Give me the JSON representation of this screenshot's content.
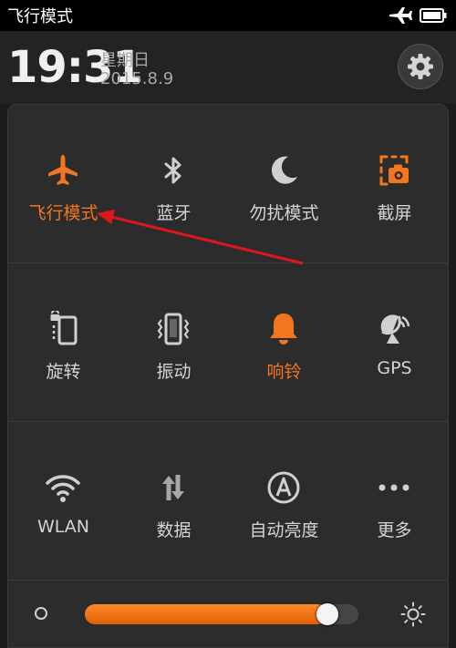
{
  "status_bar": {
    "title": "飞行模式",
    "icons": [
      "airplane-icon",
      "battery-icon"
    ]
  },
  "header": {
    "time": "19:31",
    "weekday": "星期日",
    "date": "2015.8.9",
    "settings_icon": "gear-icon"
  },
  "toggles": [
    {
      "label": "飞行模式",
      "icon": "airplane-icon",
      "active": true
    },
    {
      "label": "蓝牙",
      "icon": "bluetooth-icon",
      "active": false
    },
    {
      "label": "勿扰模式",
      "icon": "moon-icon",
      "active": false
    },
    {
      "label": "截屏",
      "icon": "screenshot-icon",
      "active": false
    },
    {
      "label": "旋转",
      "icon": "rotation-lock-icon",
      "active": false
    },
    {
      "label": "振动",
      "icon": "vibrate-icon",
      "active": false
    },
    {
      "label": "响铃",
      "icon": "bell-icon",
      "active": true
    },
    {
      "label": "GPS",
      "icon": "gps-icon",
      "active": false
    },
    {
      "label": "WLAN",
      "icon": "wifi-icon",
      "active": false
    },
    {
      "label": "数据",
      "icon": "data-transfer-icon",
      "active": false
    },
    {
      "label": "自动亮度",
      "icon": "auto-brightness-icon",
      "active": false
    },
    {
      "label": "更多",
      "icon": "more-icon",
      "active": false
    }
  ],
  "brightness": {
    "level": 0.92,
    "low_icon": "brightness-low-icon",
    "high_icon": "brightness-high-icon"
  },
  "colors": {
    "accent": "#f2761e",
    "annotation_arrow": "#e0161e",
    "inactive_icon": "#d0d0d0"
  }
}
